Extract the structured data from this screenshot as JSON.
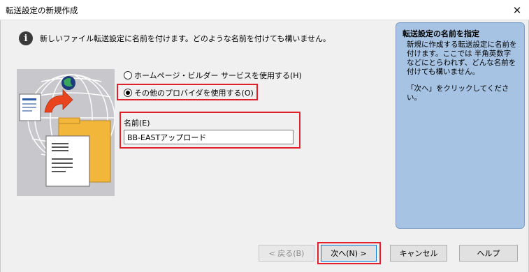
{
  "window": {
    "title": "転送設定の新規作成",
    "close_symbol": "✕"
  },
  "intro": {
    "icon_glyph": "i",
    "text": "新しいファイル転送設定に名前を付けます。どのような名前を付けても構いません。"
  },
  "options": [
    {
      "label": "ホームページ・ビルダー サービスを使用する(H)",
      "checked": false
    },
    {
      "label": "その他のプロバイダを使用する(O)",
      "checked": true
    }
  ],
  "name_field": {
    "label": "名前(E)",
    "value": "BB-EASTアップロード"
  },
  "side_panel": {
    "title": "転送設定の名前を指定",
    "body": "新規に作成する転送設定に名前を付けます。ここでは 半角英数字などにとらわれず、どんな名前を付けても構いません。",
    "hint": "「次へ」をクリックしてください。"
  },
  "buttons": {
    "back": "< 戻る(B)",
    "next": "次へ(N) >",
    "cancel": "キャンセル",
    "help": "ヘルプ"
  },
  "colors": {
    "highlight": "#e0202a",
    "panel": "#a6c3e4",
    "folder": "#f2b63a",
    "arrow": "#e8451e"
  }
}
